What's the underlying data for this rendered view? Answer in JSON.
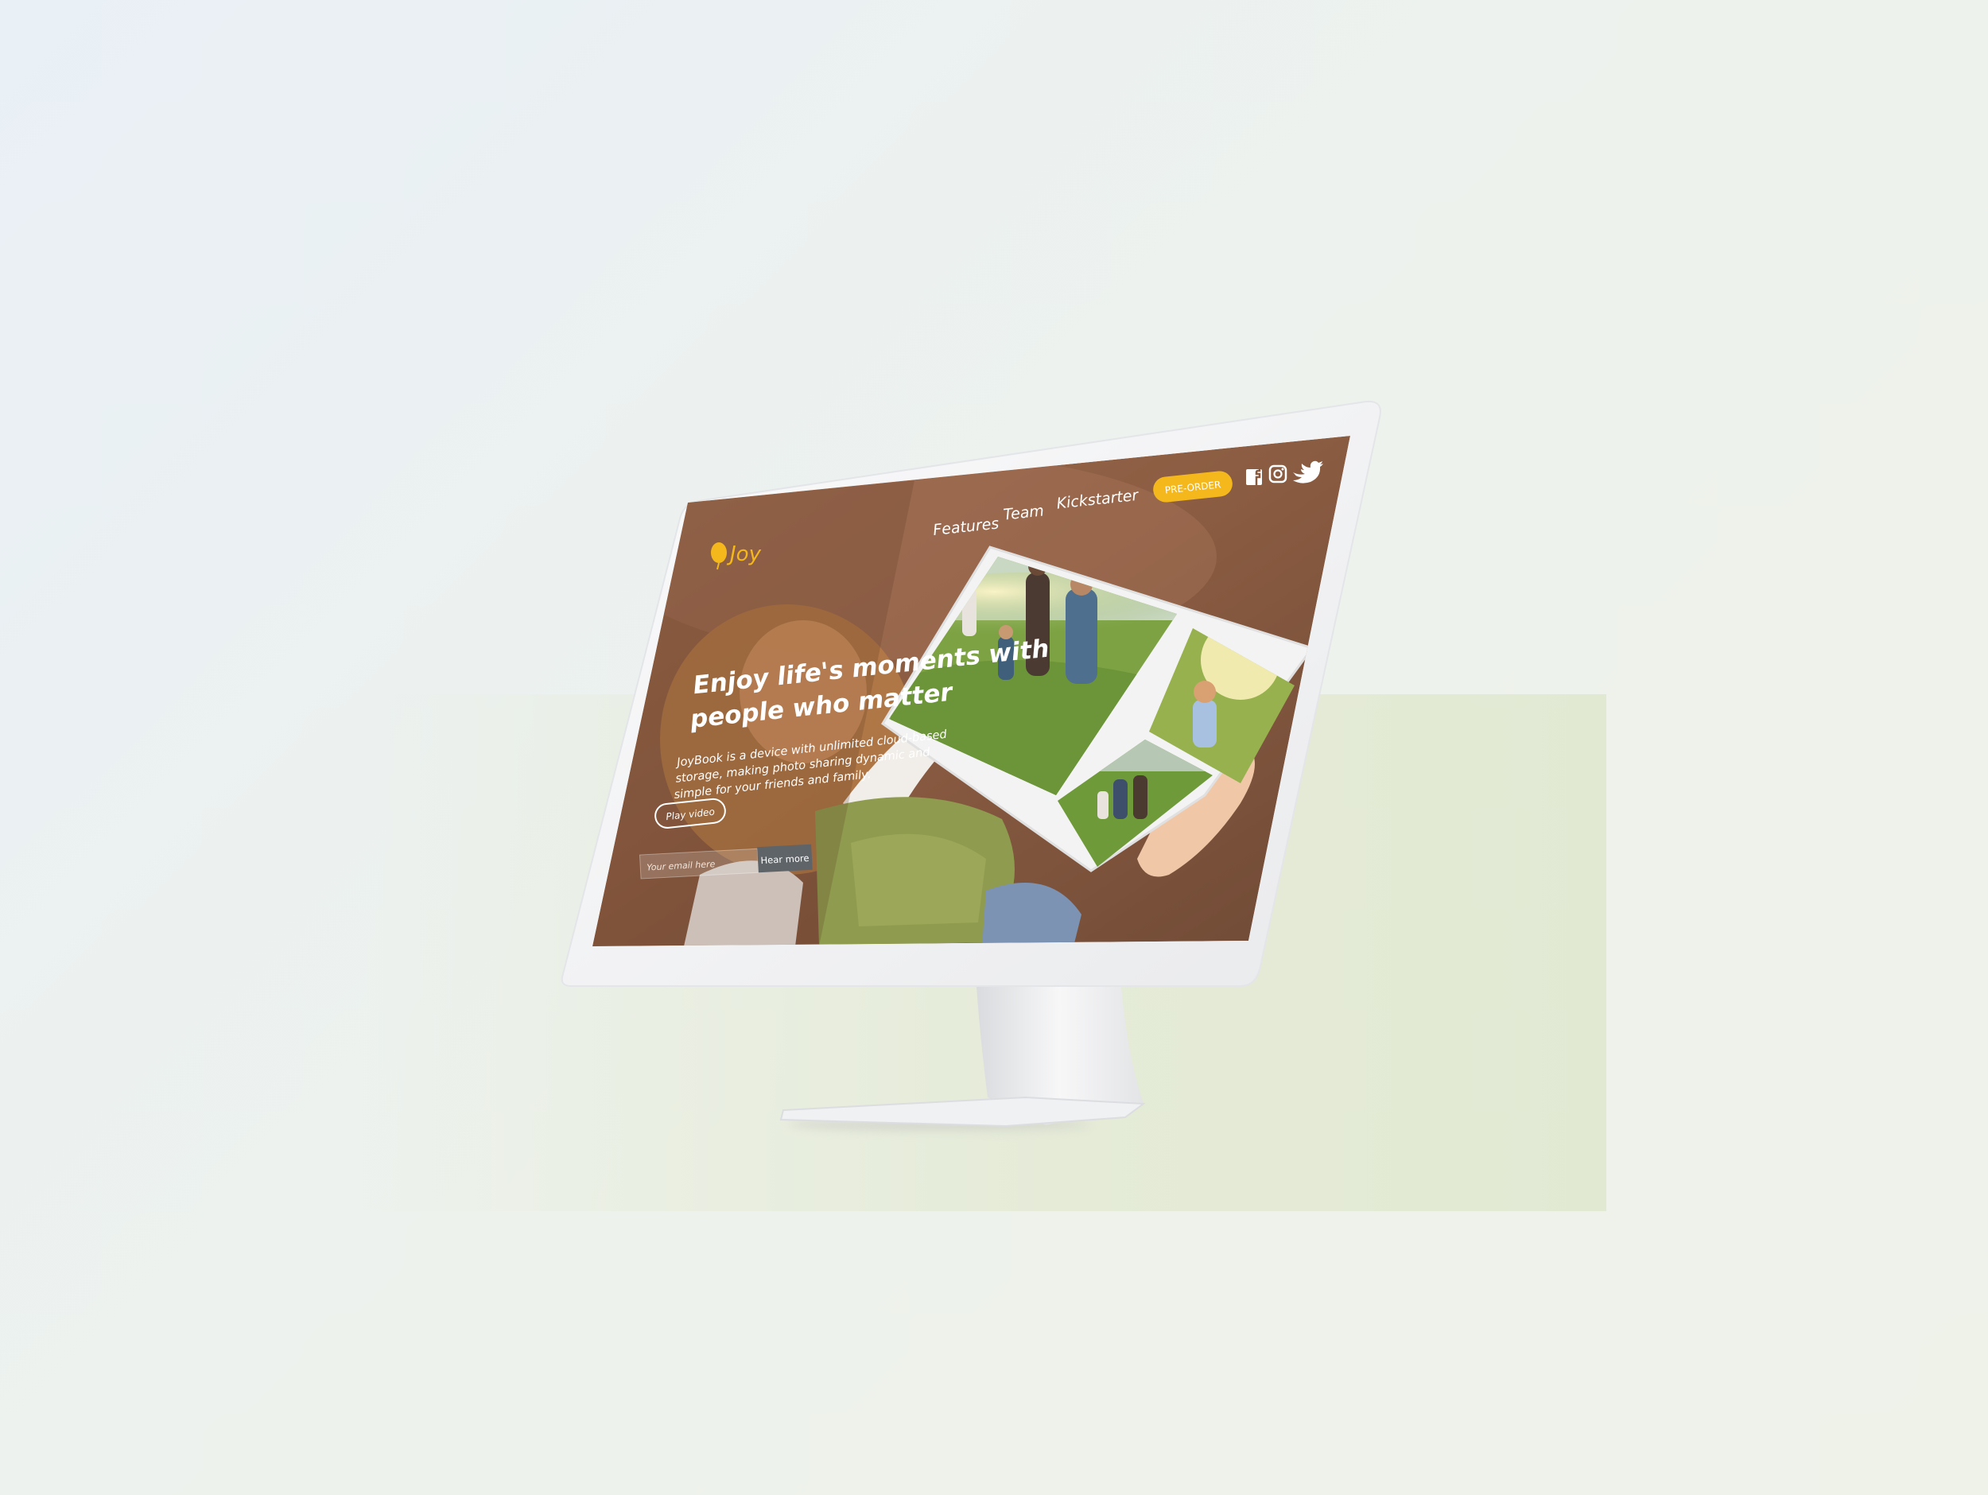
{
  "site": {
    "logo_text": "Joy",
    "nav": {
      "features": "Features",
      "team": "Team",
      "kickstarter": "Kickstarter"
    },
    "preorder_label": "PRE-ORDER",
    "social_icons": [
      "facebook-icon",
      "instagram-icon",
      "twitter-icon"
    ],
    "hero": {
      "headline_line1": "Enjoy life's moments with",
      "headline_line2": "people who matter",
      "body_line1": "JoyBook is a device with unlimited cloud-based",
      "body_line2": "storage, making photo sharing dynamic and",
      "body_line3": "simple for your friends and family.",
      "play_video_label": "Play video"
    },
    "signup": {
      "email_placeholder": "Your email here",
      "button_label": "Hear more"
    }
  },
  "colors": {
    "accent": "#f5b81c",
    "hero_brown": "#8a5a3e",
    "email_button": "#5f6468",
    "monitor_frame": "#f4f5f6"
  }
}
